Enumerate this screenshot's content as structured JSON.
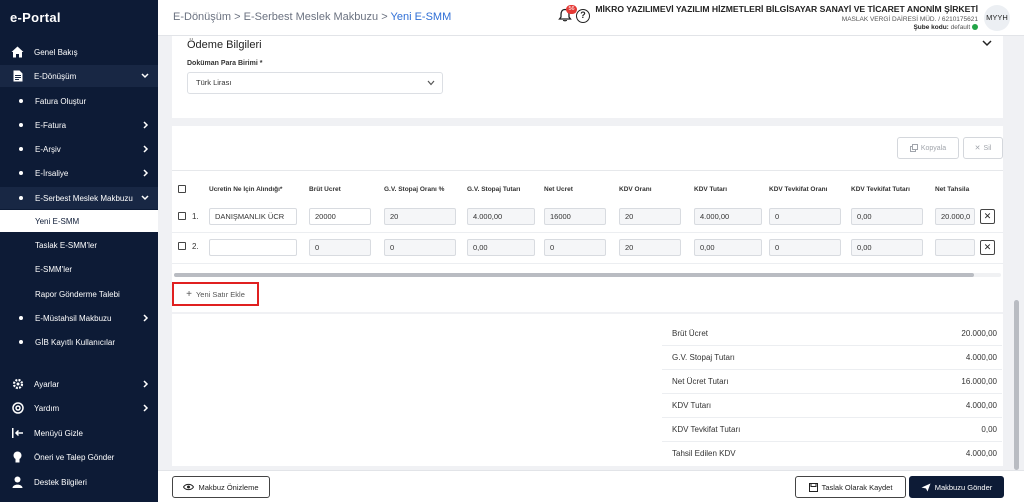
{
  "app": {
    "logo": "e-Portal"
  },
  "sidebar": {
    "items": [
      {
        "label": "Genel Bakış",
        "icon": "home-icon"
      },
      {
        "label": "E-Dönüşüm",
        "icon": "document-icon"
      },
      {
        "label": "Fatura Oluştur"
      },
      {
        "label": "E-Fatura"
      },
      {
        "label": "E-Arşiv"
      },
      {
        "label": "E-İrsaliye"
      },
      {
        "label": "E-Serbest Meslek Makbuzu"
      },
      {
        "label": "Yeni E-SMM"
      },
      {
        "label": "Taslak E-SMM'ler"
      },
      {
        "label": "E-SMM'ler"
      },
      {
        "label": "Rapor Gönderme Talebi"
      },
      {
        "label": "E-Müstahsil Makbuzu"
      },
      {
        "label": "GİB Kayıtlı Kullanıcılar"
      },
      {
        "label": "Ayarlar",
        "icon": "gear-icon"
      },
      {
        "label": "Yardım",
        "icon": "lifebuoy-icon"
      },
      {
        "label": "Menüyü Gizle",
        "icon": "collapse-icon"
      },
      {
        "label": "Öneri ve Talep Gönder",
        "icon": "lightbulb-icon"
      },
      {
        "label": "Destek Bilgileri",
        "icon": "user-icon"
      }
    ]
  },
  "header": {
    "breadcrumb": [
      "E-Dönüşüm",
      "E-Serbest Meslek Makbuzu",
      "Yeni E-SMM"
    ],
    "separator": ">",
    "notification_count": "56",
    "company_name": "MİKRO YAZILIMEVİ YAZILIM HİZMETLERİ BİLGİSAYAR SANAYİ VE TİCARET ANONİM ŞİRKETİ",
    "tax_info": "MASLAK VERGİ DAİRESİ MÜD. / 6210175621",
    "branch_label": "Şube kodu:",
    "branch_value": "default",
    "avatar": "MYYH"
  },
  "payment": {
    "title": "Ödeme Bilgileri",
    "currency_label": "Doküman Para Birimi *",
    "currency_value": "Türk Lirası"
  },
  "table": {
    "copy_label": "Kopyala",
    "delete_label": "Sil",
    "columns": [
      "Ücretin Ne İçin Alındığı*",
      "Brüt Ücret",
      "G.V. Stopaj Oranı %",
      "G.V. Stopaj Tutarı",
      "Net Ücret",
      "KDV Oranı",
      "KDV Tutarı",
      "KDV Tevkifat Oranı",
      "KDV Tevkifat Tutarı",
      "Net Tahsila"
    ],
    "rows": [
      {
        "no": "1.",
        "cells": [
          "DANIŞMANLIK ÜCR",
          "20000",
          "20",
          "4.000,00",
          "16000",
          "20",
          "4.000,00",
          "0",
          "0,00",
          "20.000,0"
        ]
      },
      {
        "no": "2.",
        "cells": [
          "",
          "0",
          "0",
          "0,00",
          "0",
          "20",
          "0,00",
          "0",
          "0,00",
          ""
        ]
      }
    ],
    "add_row_label": "Yeni Satır Ekle"
  },
  "totals": [
    {
      "label": "Brüt Ücret",
      "value": "20.000,00"
    },
    {
      "label": "G.V. Stopaj Tutarı",
      "value": "4.000,00"
    },
    {
      "label": "Net Ücret Tutarı",
      "value": "16.000,00"
    },
    {
      "label": "KDV Tutarı",
      "value": "4.000,00"
    },
    {
      "label": "KDV Tevkifat Tutarı",
      "value": "0,00"
    },
    {
      "label": "Tahsil Edilen KDV",
      "value": "4.000,00"
    }
  ],
  "footer": {
    "preview_label": "Makbuz Önizleme",
    "save_draft_label": "Taslak Olarak Kaydet",
    "send_label": "Makbuzu Gönder"
  },
  "colors": {
    "sidebar_bg": "#0d1b36",
    "accent_blue": "#2f6fd6",
    "highlight_red": "#e02020",
    "status_green": "#22a447"
  }
}
